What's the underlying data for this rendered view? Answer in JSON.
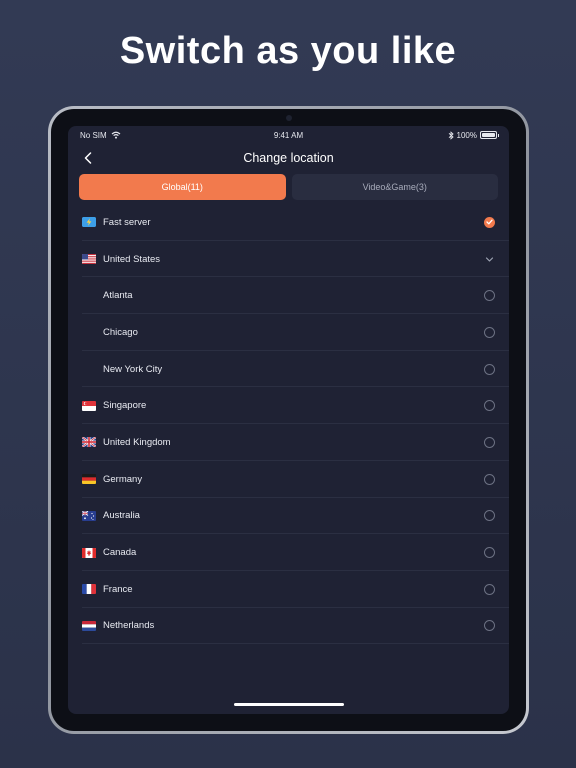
{
  "headline": "Switch as you like",
  "status_bar": {
    "carrier": "No SIM",
    "time": "9:41 AM",
    "battery": "100%",
    "battery_level": 1.0
  },
  "nav": {
    "title": "Change location",
    "back_icon": "chevron-left-icon"
  },
  "tabs": [
    {
      "label": "Global(11)",
      "active": true
    },
    {
      "label": "Video&Game(3)",
      "active": false
    }
  ],
  "locations": {
    "fast_server": {
      "label": "Fast server",
      "icon": "lightning-icon",
      "selected": true
    },
    "united_states": {
      "label": "United States",
      "expanded": true,
      "cities": [
        "Atlanta",
        "Chicago",
        "New York City"
      ]
    },
    "countries": [
      "Singapore",
      "United Kingdom",
      "Germany",
      "Australia",
      "Canada",
      "France",
      "Netherlands"
    ]
  },
  "colors": {
    "accent": "#f27a4d",
    "background": "#323a54",
    "screen": "#1f2234",
    "tab_inactive": "#292d40"
  }
}
